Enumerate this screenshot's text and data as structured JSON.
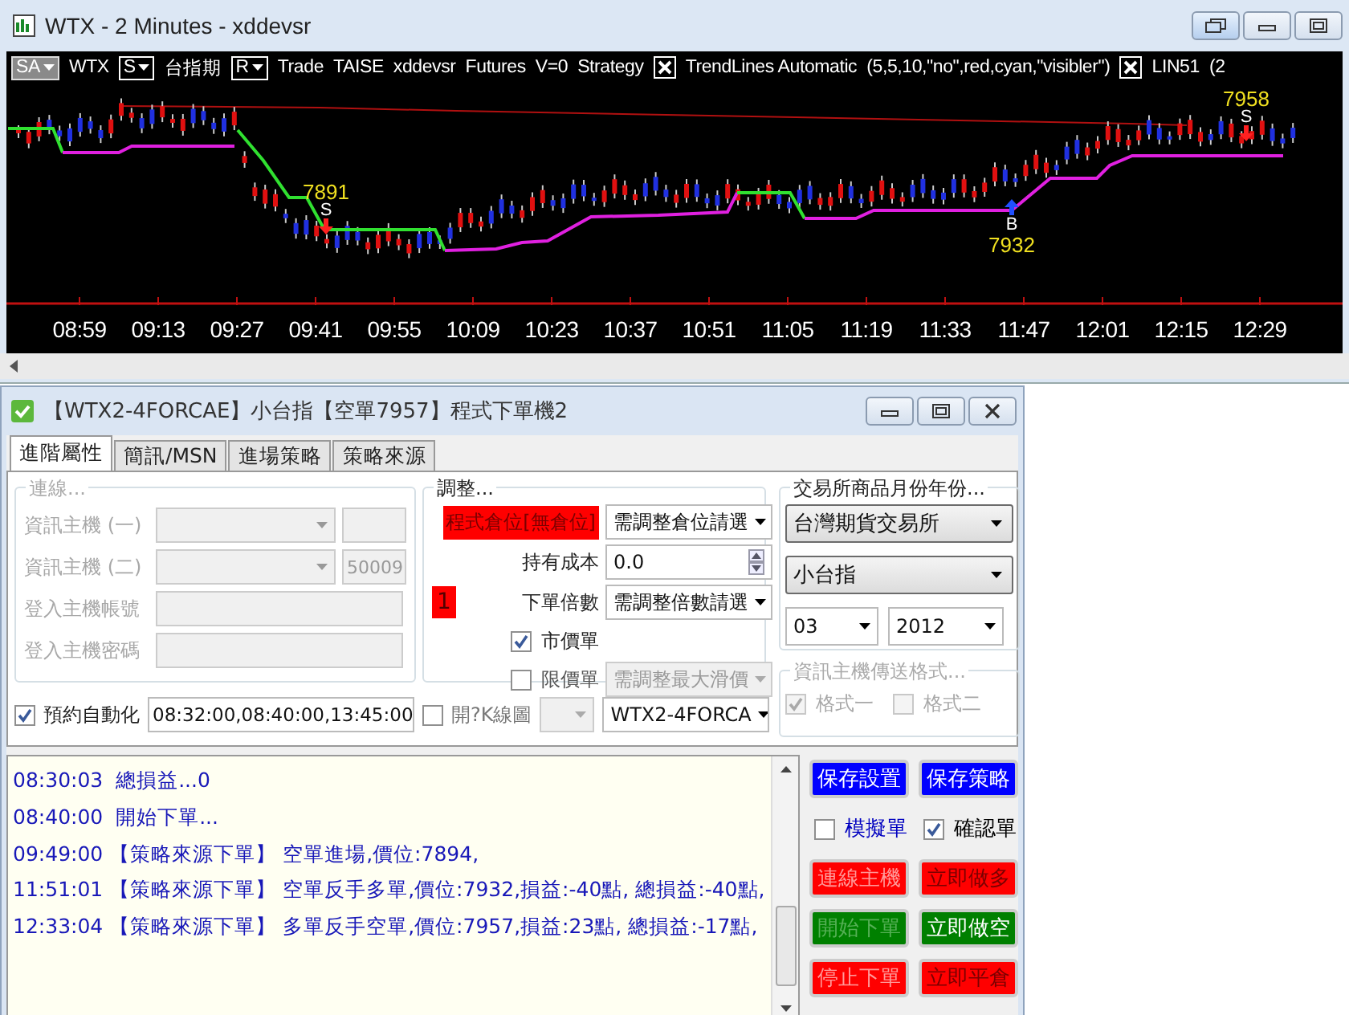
{
  "chart_window": {
    "title": "WTX - 2 Minutes - xddevsr",
    "header": [
      {
        "kind": "menu",
        "label": "SA",
        "filled": true
      },
      {
        "kind": "text",
        "text": "WTX"
      },
      {
        "kind": "menu",
        "label": "S",
        "filled": false
      },
      {
        "kind": "text",
        "text": "台指期"
      },
      {
        "kind": "menu",
        "label": "R",
        "filled": false
      },
      {
        "kind": "text",
        "text": "Trade"
      },
      {
        "kind": "text",
        "text": "TAISE"
      },
      {
        "kind": "text",
        "text": "xddevsr"
      },
      {
        "kind": "text",
        "text": "Futures"
      },
      {
        "kind": "text",
        "text": "V=0"
      },
      {
        "kind": "text",
        "text": "Strategy"
      },
      {
        "kind": "close"
      },
      {
        "kind": "text",
        "text": "TrendLines Automatic"
      },
      {
        "kind": "text",
        "text": "(5,5,10,\"no\",red,cyan,\"visibler\")"
      },
      {
        "kind": "close"
      },
      {
        "kind": "text",
        "text": "LIN51"
      },
      {
        "kind": "text",
        "text": "(2"
      }
    ],
    "signals": [
      {
        "kind": "sell",
        "letter": "S",
        "price": "7891"
      },
      {
        "kind": "buy",
        "letter": "B",
        "price": "7932"
      },
      {
        "kind": "sell",
        "letter": "S",
        "price": "7958"
      }
    ],
    "time_axis": [
      "08:59",
      "09:13",
      "09:27",
      "09:41",
      "09:55",
      "10:09",
      "10:23",
      "10:37",
      "10:51",
      "11:05",
      "11:19",
      "11:33",
      "11:47",
      "12:01",
      "12:15",
      "12:29"
    ]
  },
  "dialog": {
    "title": "【WTX2-4FORCAE】小台指【空單7957】程式下單機2",
    "tabs": [
      {
        "label": "進階屬性",
        "selected": true
      },
      {
        "label": "簡訊/MSN",
        "selected": false
      },
      {
        "label": "進場策略",
        "selected": false
      },
      {
        "label": "策略來源",
        "selected": false
      }
    ],
    "connection": {
      "legend": "連線...",
      "disabled": true,
      "rows": [
        {
          "kind": "host",
          "label": "資訊主機 (一)"
        },
        {
          "kind": "host",
          "label": "資訊主機 (二)",
          "port": "50009"
        },
        {
          "kind": "text",
          "label": "登入主機帳號"
        },
        {
          "kind": "text",
          "label": "登入主機密碼"
        }
      ]
    },
    "adjust": {
      "legend": "調整...",
      "position_label": "程式倉位[無倉位]",
      "position_select": "需調整倉位請選",
      "cost_label": "持有成本",
      "cost_value": "0.0",
      "badge": "1",
      "multiplier_label": "下單倍數",
      "multiplier_select": "需調整倍數請選",
      "market_order": {
        "label": "市價單",
        "checked": true
      },
      "limit_order": {
        "label": "限價單",
        "checked": false
      },
      "slippage_select": {
        "value": "需調整最大滑價",
        "disabled": true
      }
    },
    "exchange": {
      "legend": "交易所商品月份年份...",
      "exchange": "台灣期貨交易所",
      "product": "小台指",
      "month": "03",
      "year": "2012"
    },
    "format": {
      "legend": "資訊主機傳送格式...",
      "disabled": true,
      "options": [
        {
          "label": "格式一",
          "checked": true
        },
        {
          "label": "格式二",
          "checked": false
        }
      ]
    },
    "schedule": {
      "label": "預約自動化",
      "checked": true,
      "value": "08:32:00,08:40:00,13:45:00"
    },
    "kline": {
      "label": "開?K線圖",
      "checked": false
    },
    "strategy_select": "WTX2-4FORCA",
    "log": [
      "08:30:03  總損益...0",
      "08:40:00  開始下單...",
      "09:49:00 【策略來源下單】 空單進場,價位:7894,",
      "11:51:01 【策略來源下單】 空單反手多單,價位:7932,損益:-40點, 總損益:-40點,",
      "12:33:04 【策略來源下單】 多單反手空單,價位:7957,損益:23點, 總損益:-17點,"
    ],
    "actions": [
      {
        "kind": "button",
        "label": "保存設置",
        "color": "#0000ff",
        "disabled": false
      },
      {
        "kind": "button",
        "label": "保存策略",
        "color": "#0000ff",
        "disabled": false
      },
      {
        "kind": "checkbox",
        "label": "模擬單",
        "checked": false,
        "color": "#0000c0"
      },
      {
        "kind": "checkbox",
        "label": "確認單",
        "checked": true,
        "color": "#000000"
      },
      {
        "kind": "button",
        "label": "連線主機",
        "color": "#ff0000",
        "disabled": true
      },
      {
        "kind": "button",
        "label": "立即做多",
        "color": "#ff0000",
        "disabled": false
      },
      {
        "kind": "button",
        "label": "開始下單",
        "color": "#008000",
        "disabled": true
      },
      {
        "kind": "button",
        "label": "立即做空",
        "color": "#008000",
        "disabled": false
      },
      {
        "kind": "button",
        "label": "停止下單",
        "color": "#ff0000",
        "disabled": true
      },
      {
        "kind": "button",
        "label": "立即平倉",
        "color": "#ff0000",
        "disabled": false
      }
    ]
  }
}
